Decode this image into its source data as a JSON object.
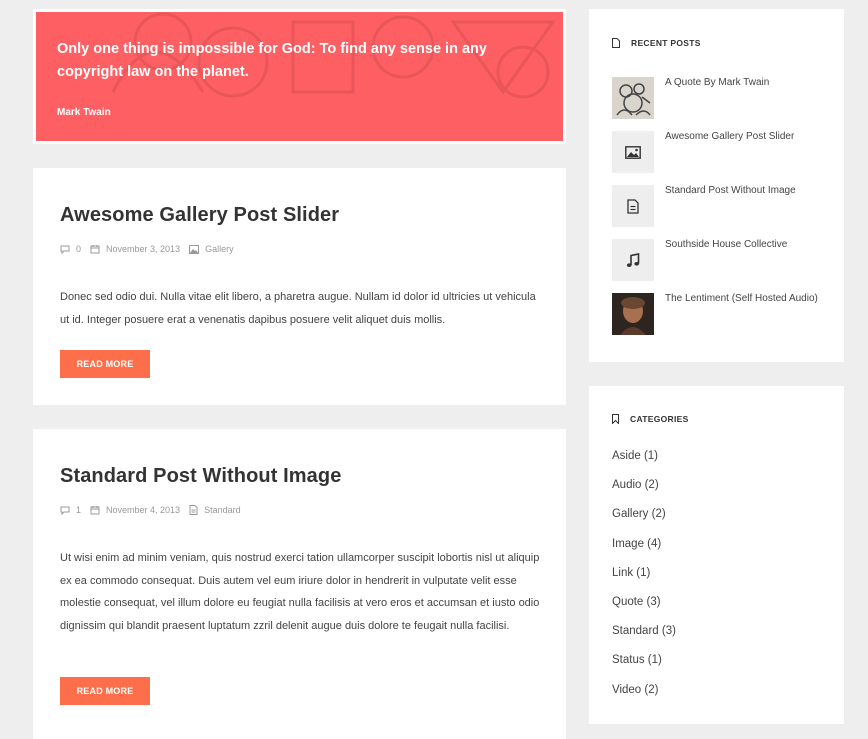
{
  "quote": {
    "text": "Only one thing is impossible for God: To find any sense in any copyright law on the planet.",
    "author": "Mark Twain"
  },
  "posts": [
    {
      "title": "Awesome Gallery Post Slider",
      "comments": "0",
      "date": "November 3, 2013",
      "category": "Gallery",
      "category_icon": "image-icon",
      "excerpt": "Donec sed odio dui. Nulla vitae elit libero, a pharetra augue. Nullam id dolor id ultricies ut vehicula ut id. Integer posuere erat a venenatis dapibus posuere velit aliquet duis mollis.",
      "button": "READ MORE"
    },
    {
      "title": "Standard Post Without Image",
      "comments": "1",
      "date": "November 4, 2013",
      "category": "Standard",
      "category_icon": "document-icon",
      "excerpt": "Ut wisi enim ad minim veniam, quis nostrud exerci tation ullamcorper suscipit lobortis nisl ut aliquip ex ea commodo consequat. Duis autem vel eum iriure dolor in hendrerit in vulputate velit esse molestie consequat, vel illum dolore eu feugiat nulla facilisis at vero eros et accumsan et iusto odio dignissim qui blandit praesent luptatum zzril delenit augue duis dolore te feugait nulla facilisi.",
      "button": "READ MORE"
    }
  ],
  "recent_posts": {
    "heading": "RECENT POSTS",
    "items": [
      {
        "title": "A Quote By Mark Twain",
        "thumb": "illustration-thumbnail"
      },
      {
        "title": "Awesome Gallery Post Slider",
        "thumb": "image-icon"
      },
      {
        "title": "Standard Post Without Image",
        "thumb": "document-icon"
      },
      {
        "title": "Southside House Collective",
        "thumb": "music-note-icon"
      },
      {
        "title": "The Lentiment (Self Hosted Audio)",
        "thumb": "portrait-thumbnail"
      }
    ]
  },
  "categories": {
    "heading": "CATEGORIES",
    "items": [
      "Aside (1)",
      "Audio (2)",
      "Gallery (2)",
      "Image (4)",
      "Link (1)",
      "Quote (3)",
      "Standard (3)",
      "Status (1)",
      "Video (2)"
    ]
  },
  "colors": {
    "quote_bg": "#fe5f63",
    "button_bg": "#fd6e4a",
    "page_bg": "#eeeeee"
  }
}
